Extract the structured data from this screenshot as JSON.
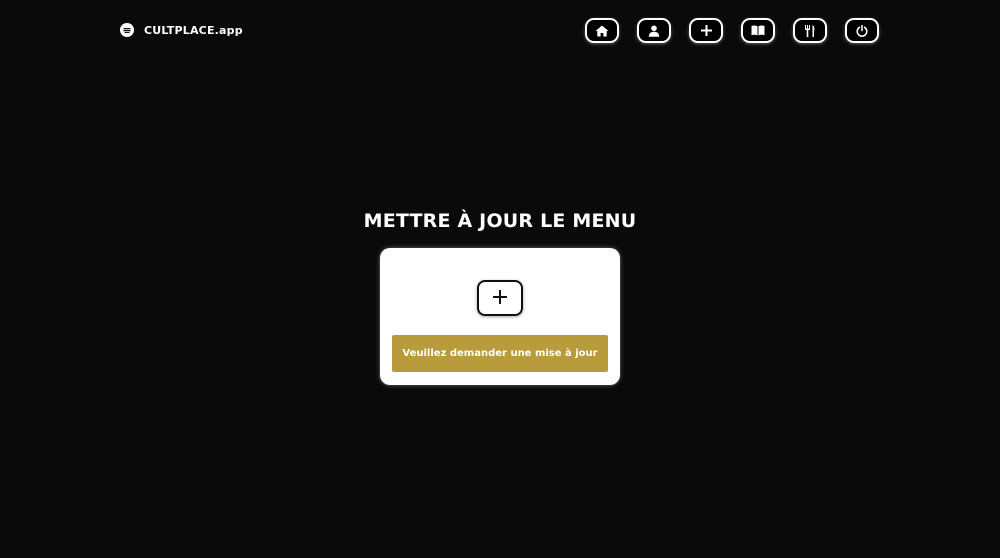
{
  "header": {
    "brand_name": "CULTPLACE.app",
    "logo_icon": "cultplace-logo-icon",
    "nav": [
      {
        "icon": "home-icon"
      },
      {
        "icon": "user-icon"
      },
      {
        "icon": "plus-icon"
      },
      {
        "icon": "book-icon"
      },
      {
        "icon": "restaurant-icon"
      },
      {
        "icon": "power-icon"
      }
    ]
  },
  "main": {
    "title": "METTRE À JOUR LE MENU",
    "card": {
      "add_icon": "plus-icon",
      "update_label": "Veuillez demander une mise à jour"
    }
  },
  "colors": {
    "background": "#0a0a0a",
    "accent": "#b89b3a",
    "card": "#ffffff"
  }
}
